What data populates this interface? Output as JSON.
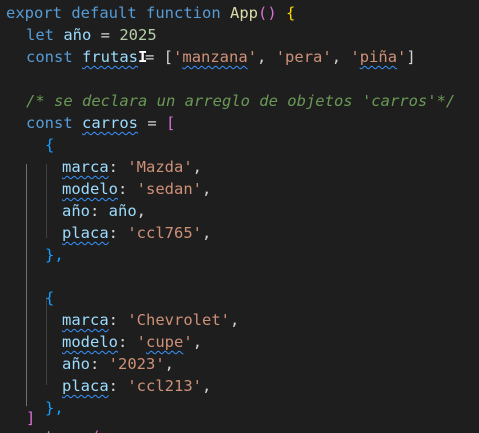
{
  "lines": [
    [
      "export",
      " ",
      "default",
      " ",
      "function",
      " ",
      "App",
      "()",
      " ",
      "{"
    ],
    [
      "let",
      " ",
      "año",
      " = ",
      "2025"
    ],
    [
      "const",
      " ",
      "frutas",
      "I",
      "= [",
      "'",
      "manzana",
      "'",
      ", ",
      "'pera'",
      ", ",
      "'",
      "piña",
      "'",
      "]"
    ],
    [
      "/* se declara un arreglo de objetos 'carros'*/"
    ],
    [
      "const",
      " ",
      "carros",
      " = ",
      "["
    ],
    [
      "{"
    ],
    [
      "marca",
      ": ",
      "'Mazda'",
      ","
    ],
    [
      "modelo",
      ": ",
      "'sedan'",
      ","
    ],
    [
      "año",
      ": ",
      "año",
      ","
    ],
    [
      "placa",
      ": ",
      "'ccl765'",
      ","
    ],
    [
      "},"
    ],
    [
      "{"
    ],
    [
      "marca",
      ": ",
      "'Chevrolet'",
      ","
    ],
    [
      "modelo",
      ": ",
      "'",
      "cupe",
      "'",
      ","
    ],
    [
      "año",
      ": ",
      "'2023'",
      ","
    ],
    [
      "placa",
      ": ",
      "'ccl213'",
      ","
    ],
    [
      "},"
    ],
    [
      "]"
    ],
    [
      "return",
      " ",
      "("
    ]
  ],
  "theme": {
    "background": "#1e1e1e",
    "keyword": "#569cd6",
    "function": "#dcdcaa",
    "variable": "#9cdcfe",
    "number": "#b5cea8",
    "string": "#ce9178",
    "comment": "#6a9955",
    "bracket_level1": "#ffd700",
    "bracket_level2": "#da70d6",
    "bracket_level3": "#179fff",
    "squiggle": "#3794ff"
  },
  "cursor_icon": "text-cursor-ibeam-icon"
}
